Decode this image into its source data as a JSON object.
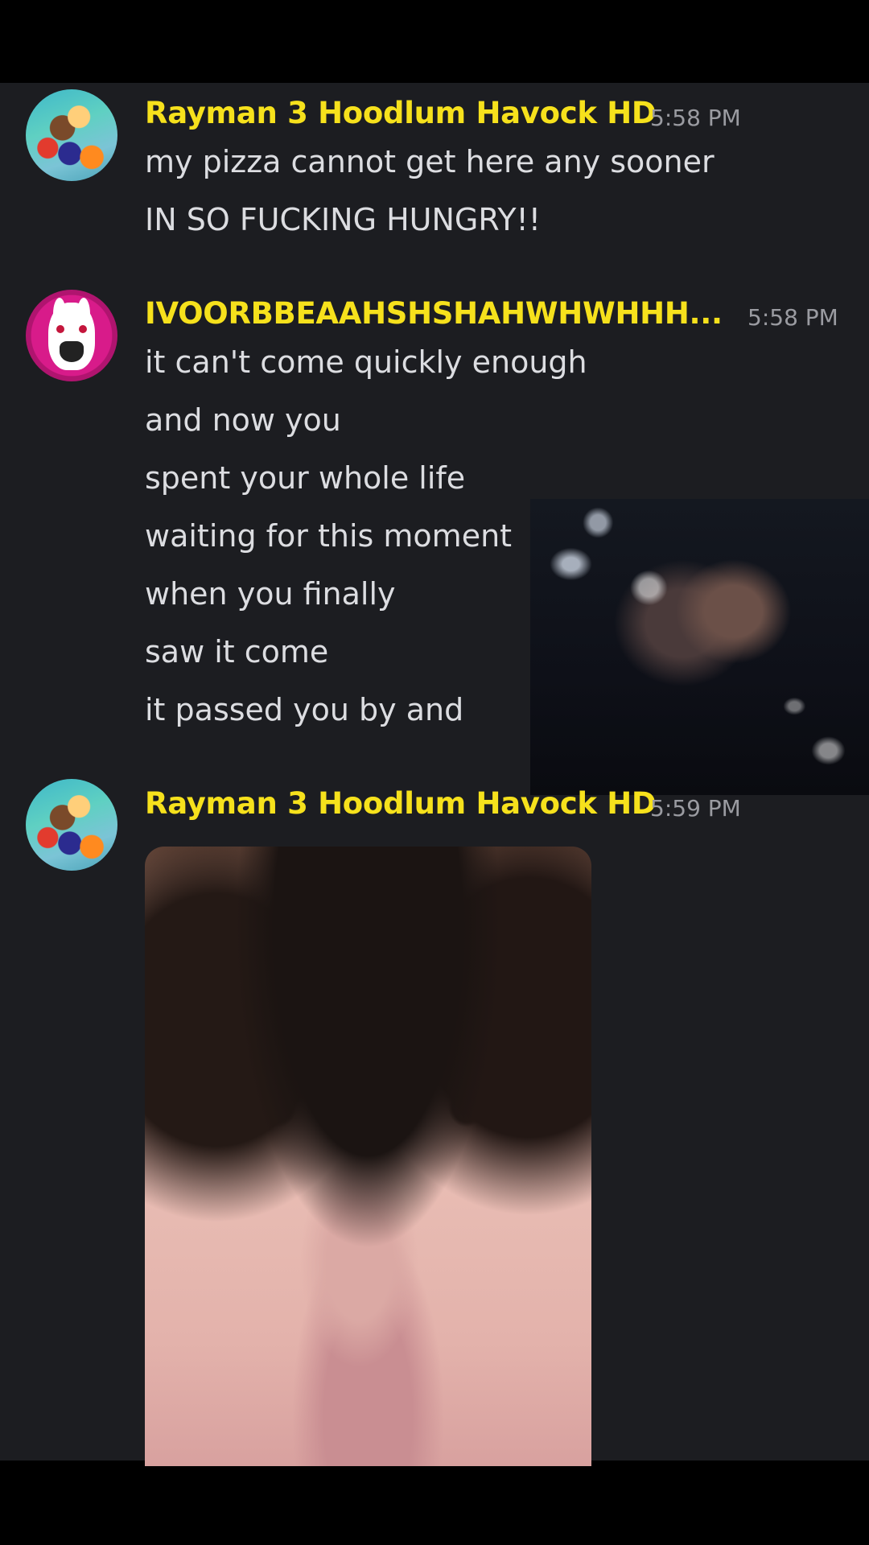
{
  "messages": [
    {
      "author": "Rayman 3 Hoodlum Havock HD",
      "time": "5:58 PM",
      "avatar": "rayman-avatar",
      "lines": [
        "my pizza cannot get here any sooner",
        "IN SO FUCKING HUNGRY!!"
      ]
    },
    {
      "author": "IVOORBBEAAHSHSHAHWHWHHH...",
      "time": "5:58 PM",
      "avatar": "rabbid-avatar",
      "lines": [
        "it can't come quickly enough",
        "and now you",
        "spent your whole life",
        "waiting for this moment",
        "when you finally",
        "saw it come",
        "it passed you by and"
      ],
      "attachment": "dark-video-thumbnail"
    },
    {
      "author": "Rayman 3 Hoodlum Havock HD",
      "time": "5:59 PM",
      "avatar": "rayman-avatar",
      "attachment": "face-photo"
    }
  ],
  "colors": {
    "background": "#1c1d21",
    "username": "#f6e11c",
    "message_text": "#dcdde1",
    "timestamp": "#9a9ba1"
  }
}
